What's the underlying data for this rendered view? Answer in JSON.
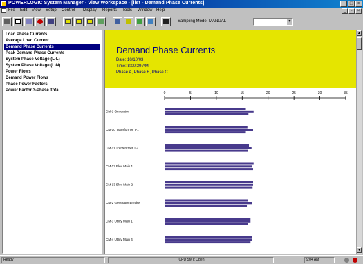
{
  "window": {
    "title": "POWERLOGIC System Manager - View Workspace - [list - Demand Phase Currents]"
  },
  "menu": [
    "File",
    "Edit",
    "View",
    "Setup",
    "Control",
    "Display",
    "Reports",
    "Tools",
    "Window",
    "Help"
  ],
  "toolbar": {
    "sampling_label": "Sampling Mode:",
    "sampling_value": "MANUAL",
    "search_placeholder": ""
  },
  "nav": {
    "selected_index": 2,
    "items": [
      "Load Phase Currents",
      "Average Load Current",
      "Demand Phase Currents",
      "Peak Demand Phase Currents",
      "System Phase Voltage (L-L)",
      "System Phase Voltage (L-N)",
      "Power Flows",
      "Demand Power Flows",
      "Phase Power Factors",
      "Power Factor 3-Phase Total"
    ]
  },
  "report": {
    "title": "Demand Phase Currents",
    "date": "Date: 10/10/03",
    "time": "Time: 8:00:39 AM",
    "phases": "Phase A, Phase B, Phase C"
  },
  "chart_data": {
    "type": "bar",
    "orientation": "horizontal",
    "xlim": [
      0,
      35
    ],
    "ticks": [
      "0",
      "5",
      "10",
      "15",
      "20",
      "25",
      "30",
      "35"
    ],
    "categories": [
      "CM-1 Generator",
      "CM-10 Transformer T-1",
      "CM-11 Transformer T-2",
      "CM-12 Elev Main 1",
      "CM-13 Elev Main 2",
      "CM-2 Generator Breaker",
      "CM-3 Utility Main 1",
      "CM-4 Utility Main 4"
    ],
    "series": [
      {
        "values": [
          15.7,
          16.0,
          16.3,
          17.2,
          17.1,
          16.1,
          16.6,
          16.9
        ]
      },
      {
        "values": [
          17.2,
          17.1,
          16.8,
          16.9,
          17.1,
          16.9,
          16.6,
          16.9
        ]
      },
      {
        "values": [
          16.2,
          15.7,
          16.1,
          17.1,
          17.0,
          15.9,
          16.1,
          16.6
        ]
      }
    ],
    "bar_color": "#483a8c",
    "background": "#ffffff"
  },
  "status": {
    "ready": "Ready",
    "mode": "CPU SMT: Open",
    "clock": "9:04 AM"
  },
  "colors": {
    "accent": "#000080",
    "header_bg": "#e5e500"
  }
}
